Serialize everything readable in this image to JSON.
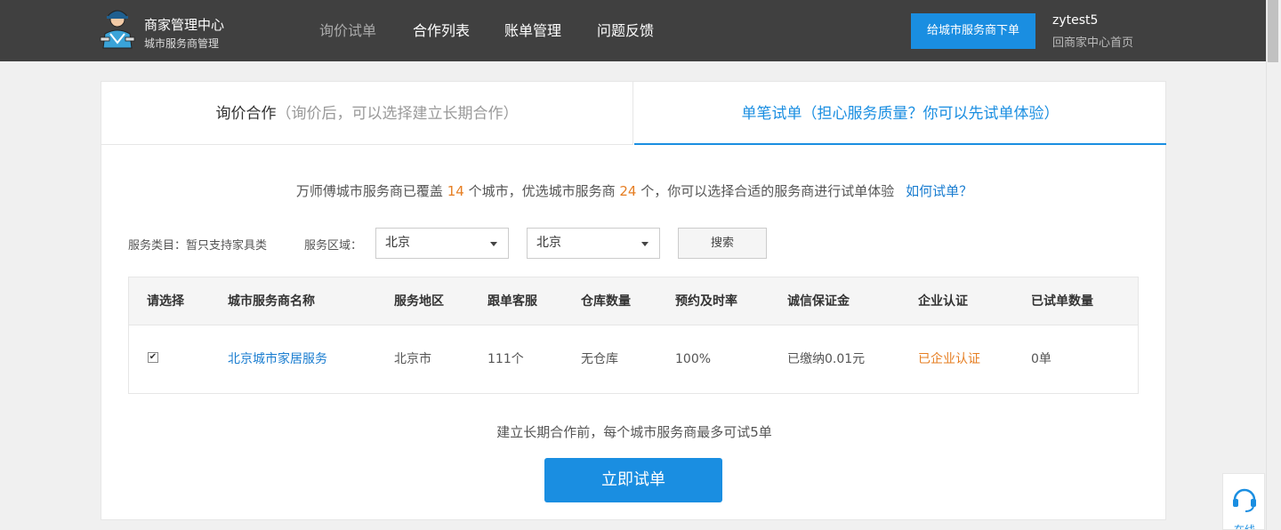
{
  "header": {
    "title": "商家管理中心",
    "subtitle": "城市服务商管理",
    "nav": [
      "询价试单",
      "合作列表",
      "账单管理",
      "问题反馈"
    ],
    "cta_label": "给城市服务商下单",
    "username": "zytest5",
    "home_link": "回商家中心首页"
  },
  "tabs": {
    "left_main": "询价合作",
    "left_hint": "（询价后，可以选择建立长期合作）",
    "right": "单笔试单（担心服务质量？你可以先试单体验）"
  },
  "intro": {
    "part1": "万师傅城市服务商已覆盖",
    "cities": "14",
    "part2": "个城市，优选城市服务商",
    "providers": "24",
    "part3": "个，你可以选择合适的服务商进行试单体验",
    "help_link": "如何试单？"
  },
  "filters": {
    "category_label": "服务类目：暂只支持家具类",
    "area_label": "服务区域：",
    "province": "北京",
    "city": "北京",
    "search_label": "搜索"
  },
  "table": {
    "headers": [
      "请选择",
      "城市服务商名称",
      "服务地区",
      "跟单客服",
      "仓库数量",
      "预约及时率",
      "诚信保证金",
      "企业认证",
      "已试单数量"
    ],
    "rows": [
      {
        "checked": true,
        "name": "北京城市家居服务",
        "region": "北京市",
        "service": "111个",
        "warehouse": "无仓库",
        "on_time_rate": "100%",
        "deposit": "已缴纳0.01元",
        "certification": "已企业认证",
        "trial_count": "0单"
      }
    ]
  },
  "note": "建立长期合作前，每个城市服务商最多可试5单",
  "submit_label": "立即试单",
  "support_label": "在线",
  "colors": {
    "header_bg": "#404040",
    "accent": "#1a8ee1",
    "link": "#1a7dd0",
    "highlight": "#e67e22"
  }
}
